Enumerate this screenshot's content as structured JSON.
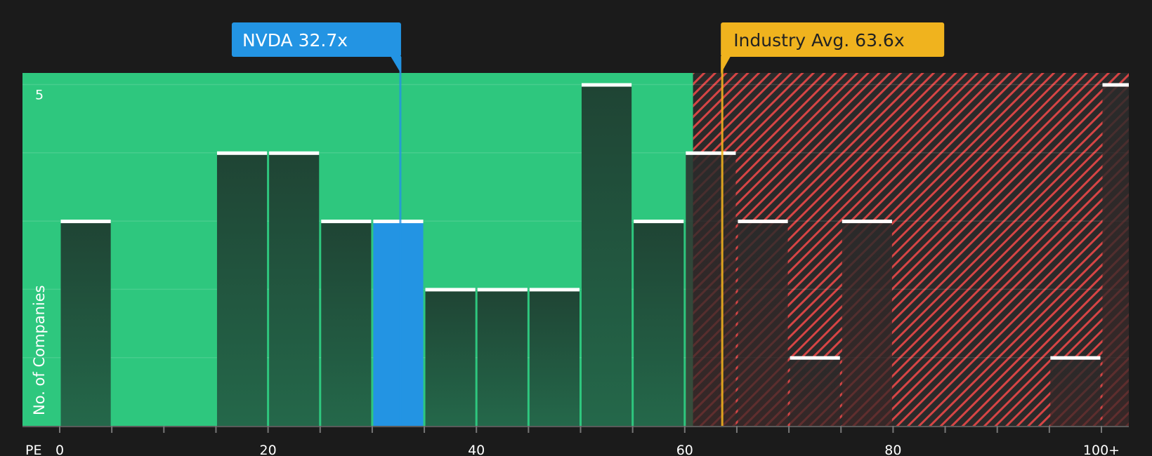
{
  "chart_data": {
    "type": "bar",
    "xlabel": "PE",
    "ylabel": "No. of Companies",
    "xlim": [
      0,
      102.5
    ],
    "ylim": [
      0,
      5.2
    ],
    "x_ticks": [
      0,
      20,
      40,
      60,
      80,
      100
    ],
    "x_tick_labels": [
      "0",
      "20",
      "40",
      "60",
      "80",
      "100+"
    ],
    "y_tick_labels": [
      {
        "value": 5,
        "label": "5"
      }
    ],
    "y_gridlines": [
      1,
      2,
      3,
      4,
      5
    ],
    "bin_width": 5,
    "bins": [
      {
        "start": 0,
        "count": 3
      },
      {
        "start": 5,
        "count": 0
      },
      {
        "start": 10,
        "count": 0
      },
      {
        "start": 15,
        "count": 4
      },
      {
        "start": 20,
        "count": 4
      },
      {
        "start": 25,
        "count": 3
      },
      {
        "start": 30,
        "count": 3,
        "highlight": true
      },
      {
        "start": 35,
        "count": 2
      },
      {
        "start": 40,
        "count": 2
      },
      {
        "start": 45,
        "count": 2
      },
      {
        "start": 50,
        "count": 5
      },
      {
        "start": 55,
        "count": 3
      },
      {
        "start": 60,
        "count": 4
      },
      {
        "start": 65,
        "count": 3
      },
      {
        "start": 70,
        "count": 1
      },
      {
        "start": 75,
        "count": 3
      },
      {
        "start": 80,
        "count": 0
      },
      {
        "start": 85,
        "count": 0
      },
      {
        "start": 90,
        "count": 0
      },
      {
        "start": 95,
        "count": 1
      },
      {
        "start": 100,
        "count": 5
      }
    ],
    "fair_zone": {
      "from": 0,
      "to": 60.8,
      "color": "#2ec77e"
    },
    "expensive_zone": {
      "from": 60.8,
      "to": 102.5,
      "color": "#d64545"
    },
    "markers": [
      {
        "label": "NVDA 32.7x",
        "value": 32.7,
        "color": "#2394e3",
        "text_color": "#ffffff"
      },
      {
        "label": "Industry Avg. 63.6x",
        "value": 63.6,
        "color": "#f0b31e",
        "text_color": "#222222"
      }
    ],
    "colors": {
      "bar": "#1f4434",
      "bar_highlight": "#2394e3",
      "bar_cap": "#ffffff",
      "background": "#1b1b1b"
    }
  }
}
